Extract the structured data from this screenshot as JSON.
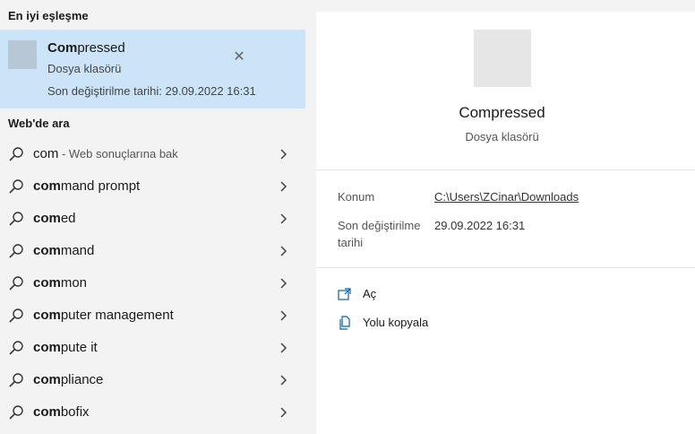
{
  "best_match": {
    "heading": "En iyi eşleşme",
    "name_bold": "Com",
    "name_rest": "pressed",
    "type": "Dosya klasörü",
    "modified": "Son değiştirilme tarihi: 29.09.2022 16:31",
    "close_glyph": "✕"
  },
  "web": {
    "heading": "Web'de ara",
    "items": [
      {
        "bold": "",
        "plain": "com",
        "suffix": " - Web sonuçlarına bak"
      },
      {
        "bold": "com",
        "plain": "mand prompt",
        "suffix": ""
      },
      {
        "bold": "com",
        "plain": "ed",
        "suffix": ""
      },
      {
        "bold": "com",
        "plain": "mand",
        "suffix": ""
      },
      {
        "bold": "com",
        "plain": "mon",
        "suffix": ""
      },
      {
        "bold": "com",
        "plain": "puter management",
        "suffix": ""
      },
      {
        "bold": "com",
        "plain": "pute it",
        "suffix": ""
      },
      {
        "bold": "com",
        "plain": "pliance",
        "suffix": ""
      },
      {
        "bold": "com",
        "plain": "bofix",
        "suffix": ""
      }
    ]
  },
  "preview": {
    "title": "Compressed",
    "subtitle": "Dosya klasörü",
    "location_label": "Konum",
    "location_value": "C:\\Users\\ZCinar\\Downloads",
    "modified_label_line1": "Son değiştirilme",
    "modified_label_line2": "tarihi",
    "modified_value": "29.09.2022 16:31",
    "actions": [
      {
        "label": "Aç",
        "icon": "open-icon"
      },
      {
        "label": "Yolu kopyala",
        "icon": "copy-icon"
      }
    ]
  },
  "colors": {
    "selected_bg": "#cce4f7",
    "panel_bg": "#f3f3f3",
    "preview_bg": "#ffffff",
    "accent": "#0063b1"
  }
}
